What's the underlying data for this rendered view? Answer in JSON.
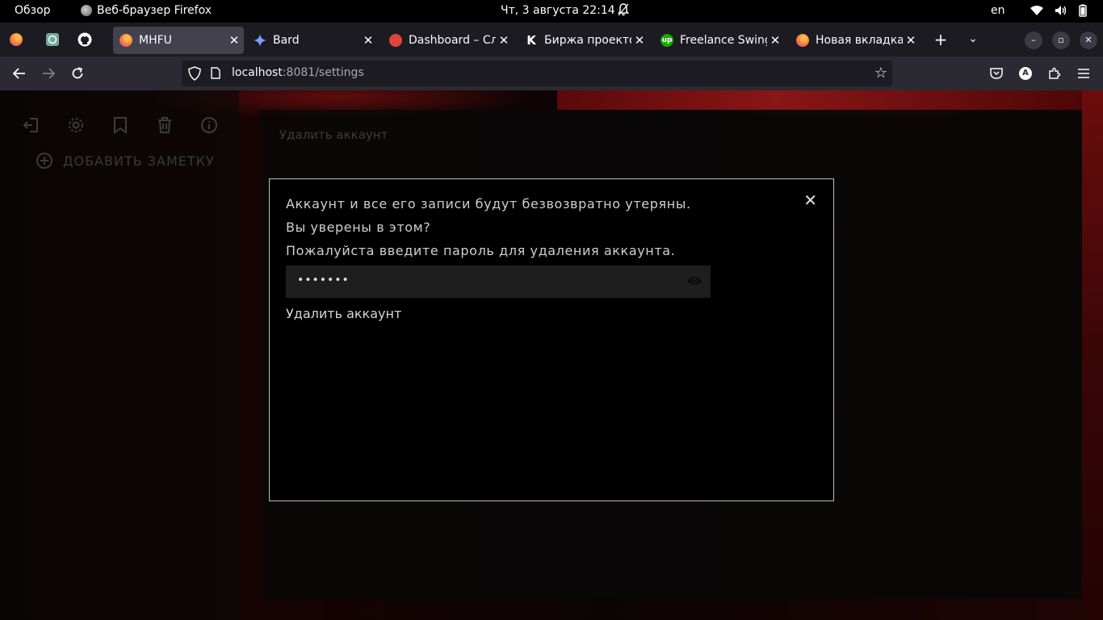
{
  "topbar": {
    "activities": "Обзор",
    "app_name": "Веб-браузер Firefox",
    "clock": "Чт, 3 августа  22:14",
    "lang": "en"
  },
  "tabs": [
    {
      "label": "MHFU",
      "active": true
    },
    {
      "label": "Bard"
    },
    {
      "label": "Dashboard – Сло"
    },
    {
      "label": "Биржа проектов"
    },
    {
      "label": "Freelance Swing"
    },
    {
      "label": "Новая вкладка"
    }
  ],
  "url": {
    "host": "localhost",
    "rest": ":8081/settings"
  },
  "sidebar": {
    "add_note": "ДОБАВИТЬ ЗАМЕТКУ"
  },
  "panel": {
    "title": "Удалить аккаунт"
  },
  "modal": {
    "line1": "Аккаунт и все его записи будут безвозвратно утеряны.",
    "line2": "Вы уверены в этом?",
    "line3": "Пожалуйста введите пароль для удаления аккаунта.",
    "password_value": "•••••••",
    "delete_label": "Удалить аккаунт",
    "close_label": "✕"
  },
  "colors": {
    "accent_red": "#8a1616",
    "modal_border": "#bdbdbd",
    "tab_active": "#42414d"
  }
}
